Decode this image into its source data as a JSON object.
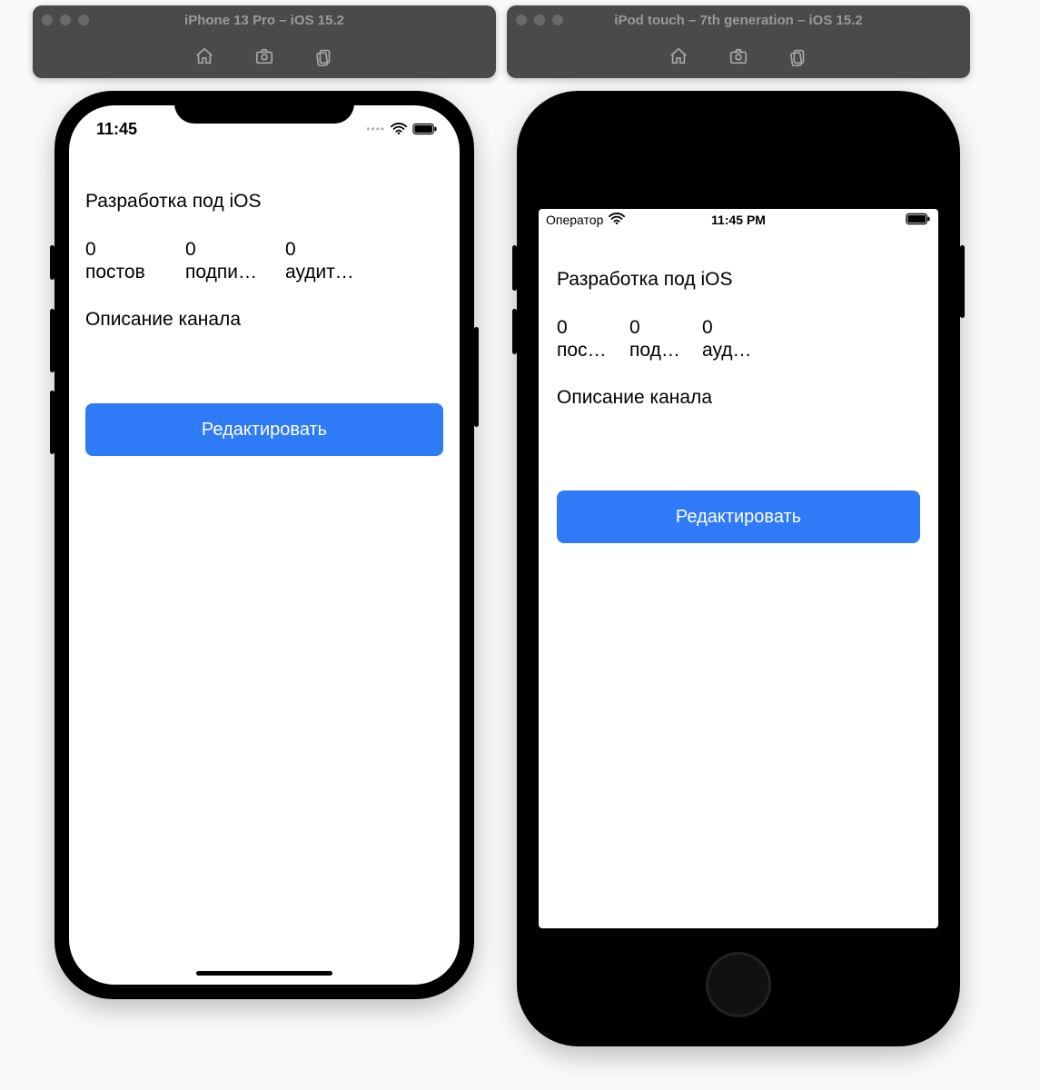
{
  "simulators": [
    {
      "title": "iPhone 13 Pro – iOS 15.2"
    },
    {
      "title": "iPod touch – 7th generation – iOS 15.2"
    }
  ],
  "iphone13": {
    "status": {
      "time": "11:45"
    },
    "app": {
      "channel_title": "Разработка под iOS",
      "stats": [
        {
          "value": "0",
          "label": "постов"
        },
        {
          "value": "0",
          "label": "подписчиков"
        },
        {
          "value": "0",
          "label": "аудитория"
        }
      ],
      "description_label": "Описание канала",
      "edit_button_label": "Редактировать"
    }
  },
  "ipod": {
    "status": {
      "carrier": "Оператор",
      "time": "11:45 PM"
    },
    "app": {
      "channel_title": "Разработка под iOS",
      "stats": [
        {
          "value": "0",
          "label": "постов"
        },
        {
          "value": "0",
          "label": "подписчиков"
        },
        {
          "value": "0",
          "label": "аудитория"
        }
      ],
      "description_label": "Описание канала",
      "edit_button_label": "Редактировать"
    }
  }
}
